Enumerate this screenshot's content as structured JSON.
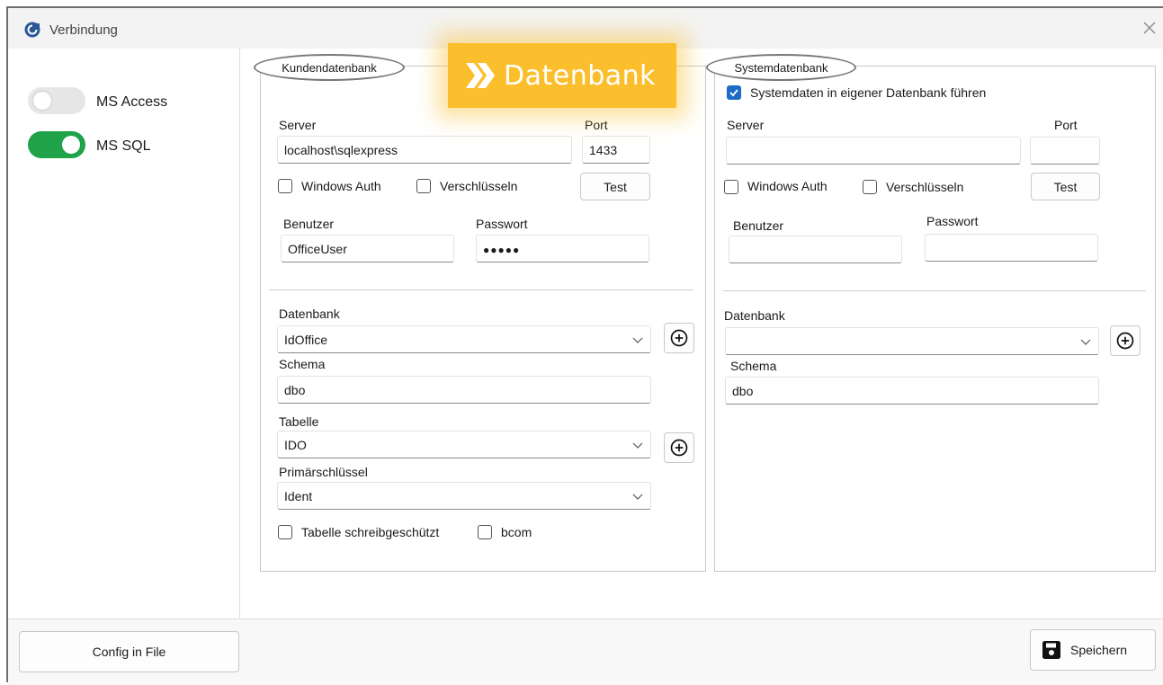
{
  "window": {
    "title": "Verbindung"
  },
  "db_types": [
    {
      "label": "MS Access",
      "checked": false
    },
    {
      "label": "MS SQL",
      "checked": true
    }
  ],
  "banner": {
    "label": "Datenbank",
    "icon": "double-chevron-right-icon",
    "color": "#fbbe2c"
  },
  "kunden": {
    "legend": "Kundendatenbank",
    "server_label": "Server",
    "server_value": "localhost\\sqlexpress",
    "port_label": "Port",
    "port_value": "1433",
    "windows_auth_label": "Windows Auth",
    "windows_auth_checked": false,
    "encrypt_label": "Verschlüsseln",
    "encrypt_checked": false,
    "test_label": "Test",
    "user_label": "Benutzer",
    "user_value": "OfficeUser",
    "password_label": "Passwort",
    "password_value": "●●●●●",
    "database_label": "Datenbank",
    "database_value": "IdOffice",
    "schema_label": "Schema",
    "schema_value": "dbo",
    "table_label": "Tabelle",
    "table_value": "IDO",
    "pk_label": "Primärschlüssel",
    "pk_value": "Ident",
    "readonly_label": "Tabelle schreibgeschützt",
    "readonly_checked": false,
    "bcom_label": "bcom",
    "bcom_checked": false
  },
  "system": {
    "legend": "Systemdatenbank",
    "own_db_label": "Systemdaten in eigener Datenbank führen",
    "own_db_checked": true,
    "server_label": "Server",
    "server_value": "",
    "port_label": "Port",
    "port_value": "",
    "windows_auth_label": "Windows Auth",
    "windows_auth_checked": false,
    "encrypt_label": "Verschlüsseln",
    "encrypt_checked": false,
    "test_label": "Test",
    "user_label": "Benutzer",
    "user_value": "",
    "password_label": "Passwort",
    "password_value": "",
    "database_label": "Datenbank",
    "database_value": "",
    "schema_label": "Schema",
    "schema_value": "dbo"
  },
  "footer": {
    "config_label": "Config in File",
    "save_label": "Speichern",
    "save_icon": "save-icon"
  },
  "colors": {
    "toggle_on": "#1fa24a",
    "toggle_off": "#e6e6e6",
    "accent": "#1e6bc6"
  }
}
